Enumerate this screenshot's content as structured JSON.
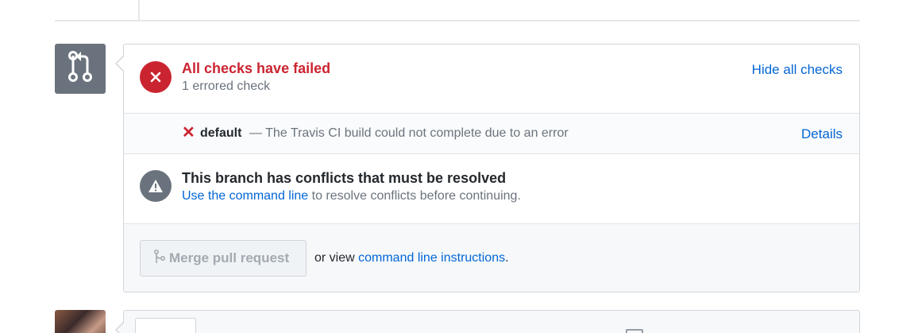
{
  "checks": {
    "title": "All checks have failed",
    "subtitle": "1 errored check",
    "toggle_label": "Hide all checks",
    "items": [
      {
        "status_glyph": "✕",
        "name": "default",
        "description": "— The Travis CI build could not complete due to an error",
        "details_label": "Details"
      }
    ]
  },
  "conflict": {
    "title": "This branch has conflicts that must be resolved",
    "link_text": "Use the command line",
    "rest_text": " to resolve conflicts before continuing."
  },
  "merge": {
    "button_label": "Merge pull request",
    "alt_prefix": "or view ",
    "alt_link": "command line instructions",
    "alt_suffix": "."
  },
  "icons": {
    "pull_request": "git-pull-request-icon",
    "fail": "x-icon",
    "alert": "alert-icon",
    "merge": "git-merge-icon"
  },
  "colors": {
    "fail_red": "#cb2431",
    "link_blue": "#0366d6",
    "muted_gray": "#6a737d"
  }
}
